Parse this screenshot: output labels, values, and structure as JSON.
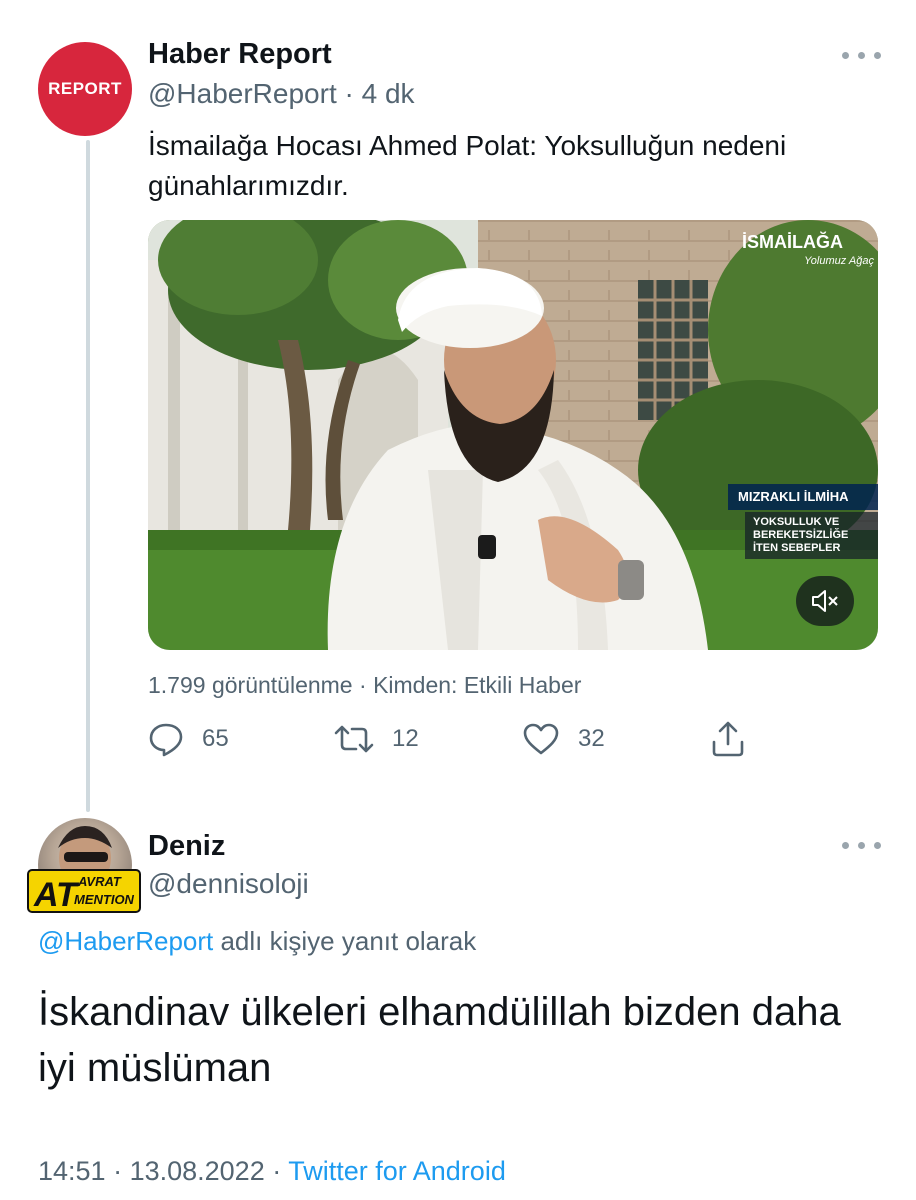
{
  "tweet": {
    "author": {
      "name": "Haber Report",
      "handle": "@HaberReport",
      "time": "4 dk",
      "avatar_text": "REPORT",
      "avatar_color": "#d7263d"
    },
    "text": "İsmailağa Hocası Ahmed Polat: Yoksulluğun nedeni günahlarımızdır.",
    "media": {
      "logo": "İSMAİLAĞA",
      "logo_sub": "Yolumuz Ağaç",
      "lower_third_title": "MIZRAKLI İLMİHA",
      "lower_third_lines": [
        "YOKSULLUK VE",
        "BEREKETSİZLİĞE",
        "İTEN SEBEPLER"
      ],
      "mute_icon": "speaker-mute-icon"
    },
    "views": "1.799 görüntülenme",
    "from": "Kimden: Etkili Haber",
    "actions": {
      "replies": "65",
      "retweets": "12",
      "likes": "32"
    }
  },
  "reply": {
    "author": {
      "name": "Deniz",
      "handle": "@dennisoloji",
      "badge_big": "AT",
      "badge_top": "AVRAT",
      "badge_bottom": "MENTION"
    },
    "replying_to_handle": "@HaberReport",
    "replying_to_suffix": " adlı kişiye yanıt olarak",
    "text": "İskandinav ülkeleri elhamdülillah bizden daha iyi müslüman",
    "time": "14:51",
    "date": "13.08.2022",
    "source": "Twitter for Android"
  },
  "colors": {
    "link": "#1d9bf0",
    "muted": "#536471",
    "text": "#0f1419"
  }
}
